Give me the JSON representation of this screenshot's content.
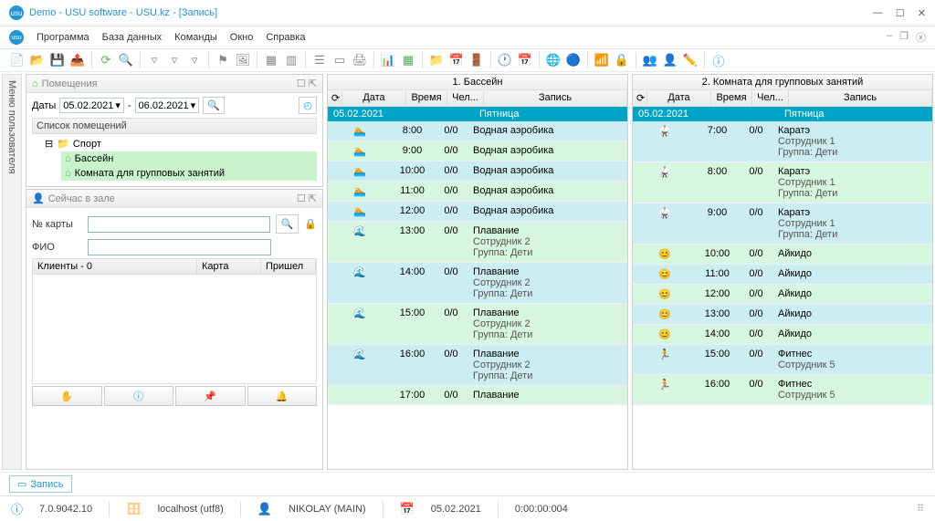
{
  "title": "Demo - USU software - USU.kz - [Запись]",
  "menu": {
    "program": "Программа",
    "database": "База данных",
    "commands": "Команды",
    "window": "Окно",
    "help": "Справка"
  },
  "sidetab": "Меню пользователя",
  "rooms_panel": {
    "title": "Помещения",
    "dates_label": "Даты",
    "date_from": "05.02.2021",
    "date_to": "06.02.2021",
    "list_header": "Список помещений",
    "root": "Спорт",
    "room1": "Бассейн",
    "room2": "Комната для групповых занятий"
  },
  "now_panel": {
    "title": "Сейчас в зале",
    "card_label": "№ карты",
    "fio_label": "ФИО",
    "clients_header": "Клиенты - 0",
    "col_card": "Карта",
    "col_came": "Пришел"
  },
  "sched1": {
    "title": "1. Бассейн",
    "cols": {
      "date": "Дата",
      "time": "Время",
      "cap": "Чел...",
      "rec": "Запись"
    },
    "day": "05.02.2021",
    "dayname": "Пятница",
    "rows": [
      {
        "ic": "🏊",
        "time": "8:00",
        "cap": "0/0",
        "rec": "Водная аэробика",
        "sub": "",
        "cls": "odd"
      },
      {
        "ic": "🏊",
        "time": "9:00",
        "cap": "0/0",
        "rec": "Водная аэробика",
        "sub": "",
        "cls": "even"
      },
      {
        "ic": "🏊",
        "time": "10:00",
        "cap": "0/0",
        "rec": "Водная аэробика",
        "sub": "",
        "cls": "odd"
      },
      {
        "ic": "🏊",
        "time": "11:00",
        "cap": "0/0",
        "rec": "Водная аэробика",
        "sub": "",
        "cls": "even"
      },
      {
        "ic": "🏊",
        "time": "12:00",
        "cap": "0/0",
        "rec": "Водная аэробика",
        "sub": "",
        "cls": "odd"
      },
      {
        "ic": "🌊",
        "time": "13:00",
        "cap": "0/0",
        "rec": "Плавание",
        "sub": "Сотрудник 2\nГруппа: Дети",
        "cls": "even"
      },
      {
        "ic": "🌊",
        "time": "14:00",
        "cap": "0/0",
        "rec": "Плавание",
        "sub": "Сотрудник 2\nГруппа: Дети",
        "cls": "odd"
      },
      {
        "ic": "🌊",
        "time": "15:00",
        "cap": "0/0",
        "rec": "Плавание",
        "sub": "Сотрудник 2\nГруппа: Дети",
        "cls": "even"
      },
      {
        "ic": "🌊",
        "time": "16:00",
        "cap": "0/0",
        "rec": "Плавание",
        "sub": "Сотрудник 2\nГруппа: Дети",
        "cls": "odd"
      },
      {
        "ic": "",
        "time": "17:00",
        "cap": "0/0",
        "rec": "Плавание",
        "sub": "",
        "cls": "even"
      }
    ]
  },
  "sched2": {
    "title": "2. Комната для групповых занятий",
    "cols": {
      "date": "Дата",
      "time": "Время",
      "cap": "Чел...",
      "rec": "Запись"
    },
    "day": "05.02.2021",
    "dayname": "Пятница",
    "rows": [
      {
        "ic": "🥋",
        "time": "7:00",
        "cap": "0/0",
        "rec": "Каратэ",
        "sub": "Сотрудник 1\nГруппа: Дети",
        "cls": "odd"
      },
      {
        "ic": "🥋",
        "time": "8:00",
        "cap": "0/0",
        "rec": "Каратэ",
        "sub": "Сотрудник 1\nГруппа: Дети",
        "cls": "even"
      },
      {
        "ic": "🥋",
        "time": "9:00",
        "cap": "0/0",
        "rec": "Каратэ",
        "sub": "Сотрудник 1\nГруппа: Дети",
        "cls": "odd"
      },
      {
        "ic": "😊",
        "time": "10:00",
        "cap": "0/0",
        "rec": "Айкидо",
        "sub": "",
        "cls": "even"
      },
      {
        "ic": "😊",
        "time": "11:00",
        "cap": "0/0",
        "rec": "Айкидо",
        "sub": "",
        "cls": "odd"
      },
      {
        "ic": "😊",
        "time": "12:00",
        "cap": "0/0",
        "rec": "Айкидо",
        "sub": "",
        "cls": "even"
      },
      {
        "ic": "😊",
        "time": "13:00",
        "cap": "0/0",
        "rec": "Айкидо",
        "sub": "",
        "cls": "odd"
      },
      {
        "ic": "😊",
        "time": "14:00",
        "cap": "0/0",
        "rec": "Айкидо",
        "sub": "",
        "cls": "even"
      },
      {
        "ic": "🏃",
        "time": "15:00",
        "cap": "0/0",
        "rec": "Фитнес",
        "sub": "Сотрудник 5",
        "cls": "odd"
      },
      {
        "ic": "🏃",
        "time": "16:00",
        "cap": "0/0",
        "rec": "Фитнес",
        "sub": "Сотрудник 5",
        "cls": "even"
      }
    ]
  },
  "footer_tab": "Запись",
  "status": {
    "version": "7.0.9042.10",
    "host": "localhost (utf8)",
    "user": "NIKOLAY (MAIN)",
    "date": "05.02.2021",
    "uptime": "0:00:00:004"
  }
}
